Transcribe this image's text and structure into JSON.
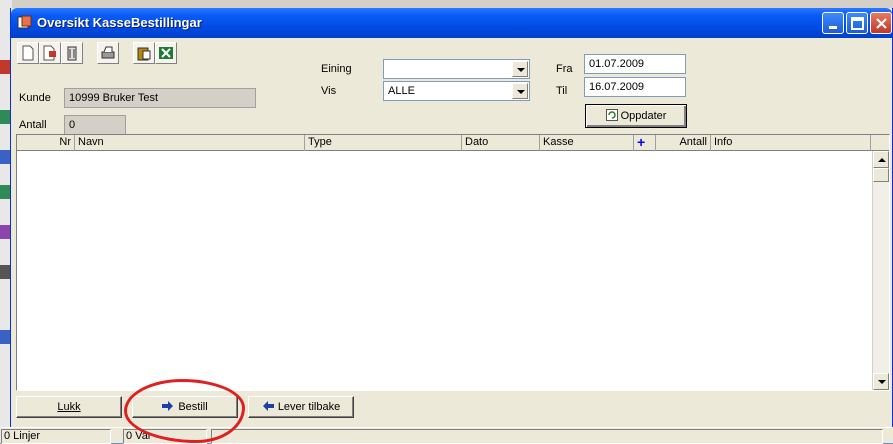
{
  "window": {
    "title": "Oversikt KasseBestillingar"
  },
  "form": {
    "kunde_label": "Kunde",
    "kunde_value": "10999 Bruker Test",
    "antall_label": "Antall",
    "antall_value": "0",
    "eining_label": "Eining",
    "eining_value": "",
    "vis_label": "Vis",
    "vis_value": "ALLE",
    "fra_label": "Fra",
    "fra_value": "01.07.2009",
    "til_label": "Til",
    "til_value": "16.07.2009",
    "oppdater_label": "Oppdater"
  },
  "toolbar_icons": [
    "new-document-icon",
    "edit-document-icon",
    "trash-icon",
    "printer-icon",
    "paste-icon",
    "excel-icon"
  ],
  "grid": {
    "columns": [
      "Nr",
      "Navn",
      "Type",
      "Dato",
      "Kasse",
      "+",
      "Antall",
      "Info"
    ],
    "rows": []
  },
  "buttons": {
    "lukk": "Lukk",
    "bestill": "Bestill",
    "lever_tilbake": "Lever tilbake"
  },
  "status": {
    "linjer": "0 Linjer",
    "varer": "0 Var"
  },
  "colors": {
    "titlebar": "#0a5bf5",
    "window_bg": "#ece9d8",
    "annotation": "#e02020",
    "arrow_blue": "#1a3fa8"
  }
}
